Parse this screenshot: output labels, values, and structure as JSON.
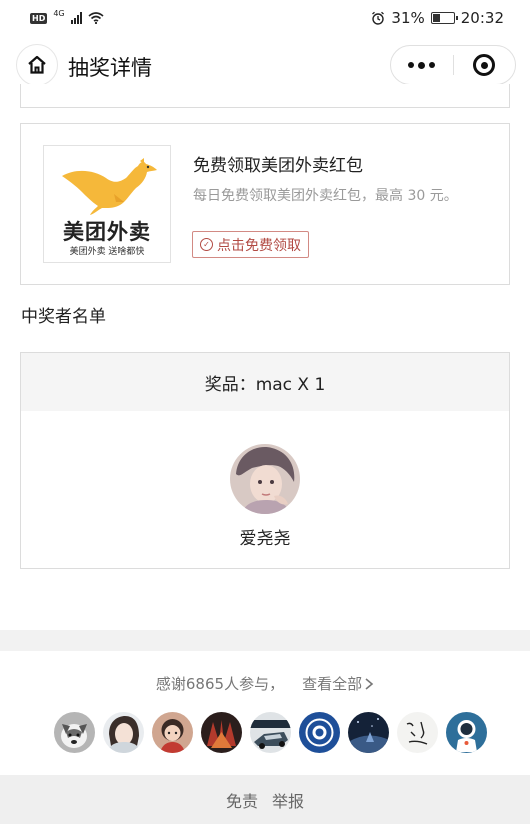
{
  "status_bar": {
    "hd_badge": "HD",
    "network": "4G",
    "alarm_icon": "alarm-clock-icon",
    "battery_percent": "31%",
    "battery_level": 0.31,
    "time": "20:32"
  },
  "nav": {
    "title": "抽奖详情",
    "home_icon": "home-icon",
    "more_icon": "more-dots-icon",
    "close_icon": "target-close-icon"
  },
  "ad": {
    "logo_name": "美团外卖",
    "logo_sub": "美团外卖 送啥都快",
    "title": "免费领取美团外卖红包",
    "description": "每日免费领取美团外卖红包，最高 30 元。",
    "button_label": "点击免费领取",
    "accent_color": "#b24a43",
    "logo_color": "#f5b83a"
  },
  "winners": {
    "section_title": "中奖者名单",
    "prize_label": "奖品：mac X 1",
    "winner_name": "爱尧尧"
  },
  "participants": {
    "thanks_text": "感谢6865人参与，",
    "view_all_label": "查看全部",
    "avatars": [
      "avatar-husky",
      "avatar-girl",
      "avatar-cartoon-red",
      "avatar-dark-pattern",
      "avatar-race-car",
      "avatar-blue-badge",
      "avatar-night-sky",
      "avatar-calligraphy",
      "avatar-astronaut"
    ]
  },
  "footer": {
    "disclaimer_label": "免责",
    "report_label": "举报"
  }
}
